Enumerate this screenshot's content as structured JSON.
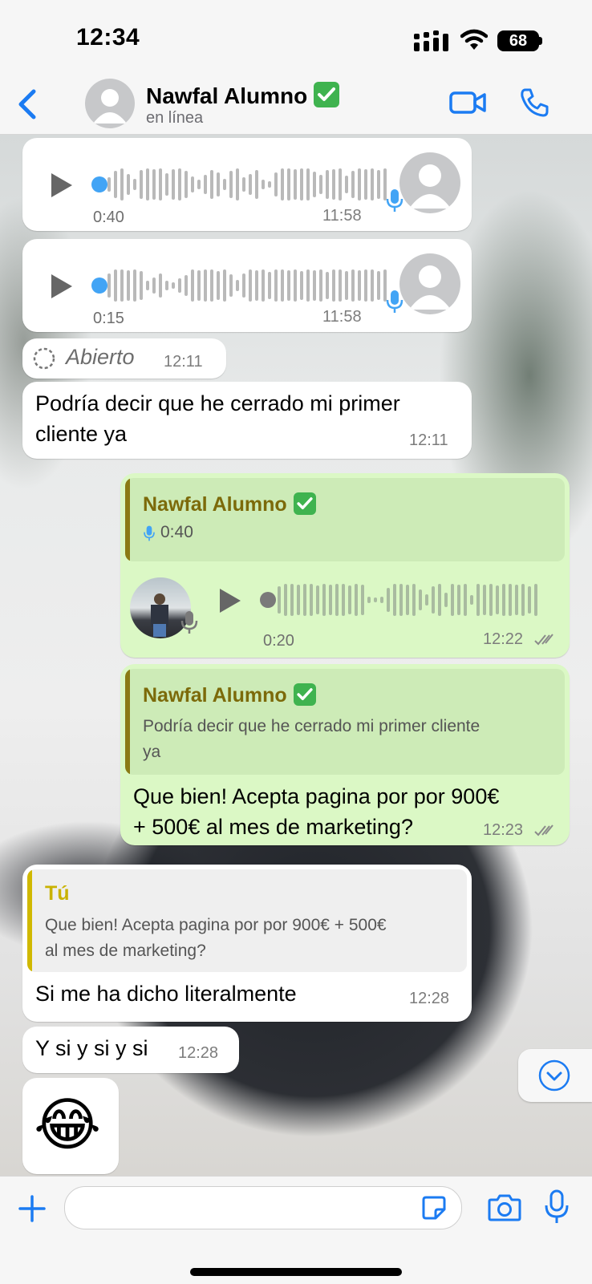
{
  "status_bar": {
    "time": "12:34",
    "battery": "68"
  },
  "header": {
    "contact_name": "Nawfal Alumno",
    "status": "en línea"
  },
  "messages": {
    "voice1": {
      "duration": "0:40",
      "time": "11:58"
    },
    "voice2": {
      "duration": "0:15",
      "time": "11:58"
    },
    "view_once": {
      "label": "Abierto",
      "time": "12:11"
    },
    "text1": {
      "line1": "Podría decir que he cerrado mi primer",
      "line2": "cliente ya",
      "time": "12:11"
    },
    "reply_voice": {
      "quote_name": "Nawfal Alumno",
      "quote_duration": "0:40",
      "duration": "0:20",
      "time": "12:22"
    },
    "reply_text": {
      "quote_name": "Nawfal Alumno",
      "quote_line1": "Podría decir que he cerrado mi primer cliente",
      "quote_line2": "ya",
      "line1": "Que bien! Acepta pagina por por 900€",
      "line2": "+ 500€ al mes de marketing?",
      "time": "12:23"
    },
    "reply_in": {
      "quote_name": "Tú",
      "quote_line1": "Que bien! Acepta pagina por por 900€ + 500€",
      "quote_line2": "al mes de marketing?",
      "text": "Si me ha dicho literalmente",
      "time": "12:28"
    },
    "text2": {
      "text": "Y si y si y si",
      "time": "12:28"
    },
    "emoji": {
      "text": "😂"
    }
  },
  "colors": {
    "accent": "#1b7bf2",
    "outgoing": "#dbf8c5",
    "quote_name_out": "#7c6a0a",
    "quote_name_in": "#c9b200",
    "voice_dot": "#42a4f5"
  },
  "icons": [
    "back-chevron-icon",
    "video-camera-icon",
    "phone-icon",
    "play-icon",
    "microphone-icon",
    "verified-check-icon",
    "plus-icon",
    "sticker-icon",
    "camera-icon",
    "scroll-down-icon",
    "double-check-icon",
    "view-once-icon"
  ]
}
